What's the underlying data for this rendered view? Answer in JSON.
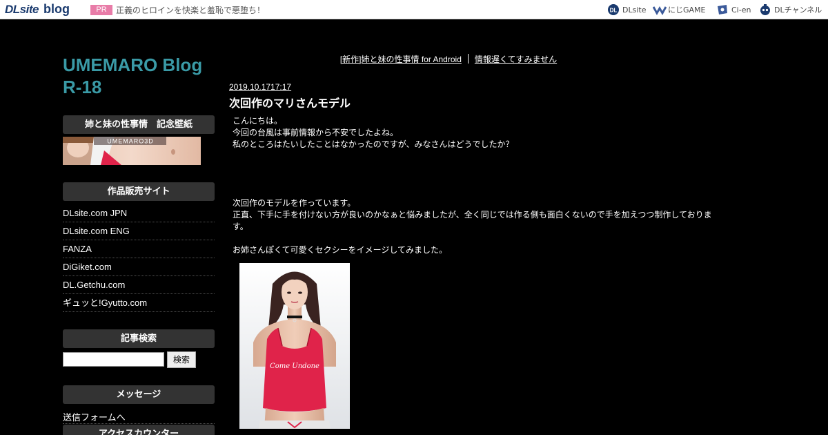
{
  "topbar": {
    "logo_dl": "DLsite",
    "logo_blog": "blog",
    "pr_badge": "PR",
    "pr_text": "正義のヒロインを快楽と羞恥で悪堕ち！",
    "services": [
      {
        "label": "DLsite",
        "icon": "dlsite-icon"
      },
      {
        "label": "にじGAME",
        "icon": "niji-game-icon"
      },
      {
        "label": "Ci-en",
        "icon": "ci-en-icon"
      },
      {
        "label": "DLチャンネル",
        "icon": "dl-channel-icon"
      }
    ]
  },
  "sidebar": {
    "blog_title": "UMEMARO Blog R-18",
    "wallpaper_heading": "姉と妹の性事情　記念壁紙",
    "banner_text": "UMEMARO3D",
    "shops_heading": "作品販売サイト",
    "shops": [
      "DLsite.com JPN",
      "DLsite.com ENG",
      "FANZA",
      "DiGiket.com",
      "DL.Getchu.com",
      "ギュッと!Gyutto.com"
    ],
    "search_heading": "記事検索",
    "search_value": "",
    "search_button": "検索",
    "message_heading": "メッセージ",
    "message_link": "送信フォームへ",
    "counter_heading": "アクセスカウンター"
  },
  "main": {
    "prev_link": "[新作]姉と妹の性事情 for Android",
    "next_link": "情報遅くてすみません",
    "post_date": "2019.10.1717:17",
    "post_title": "次回作のマリさんモデル",
    "paragraphs": [
      "こんにちは。",
      "今回の台風は事前情報から不安でしたよね。",
      "私のところはたいしたことはなかったのですが、みなさんはどうでしたか？",
      "次回作のモデルを作っています。",
      "正直、下手に手を付けない方が良いのかなぁと悩みましたが、全く同じでは作る側も面白くないので手を加えつつ制作しております。",
      "お姉さんぽくて可愛くセクシーをイメージしてみました。"
    ],
    "image_caption": "Come Undone"
  },
  "colors": {
    "title_teal": "#3a9aa6",
    "pr_pink": "#e87ca8",
    "brand_navy": "#1a3a6e",
    "top_red": "#e0234a"
  }
}
